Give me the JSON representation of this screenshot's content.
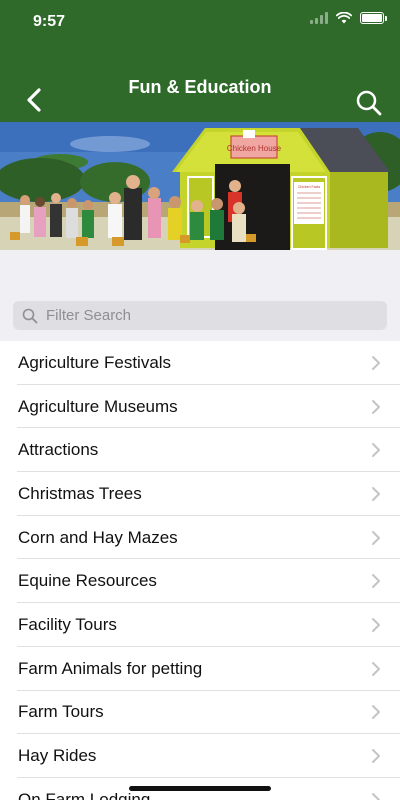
{
  "status_bar": {
    "time": "9:57"
  },
  "nav": {
    "title": "Fun & Education"
  },
  "hero": {
    "sign_text": "Chicken House",
    "notice_text": "Chicken Facts"
  },
  "search": {
    "placeholder": "Filter Search"
  },
  "categories": [
    {
      "label": "Agriculture Festivals"
    },
    {
      "label": "Agriculture Museums"
    },
    {
      "label": "Attractions"
    },
    {
      "label": "Christmas Trees"
    },
    {
      "label": "Corn and Hay Mazes"
    },
    {
      "label": "Equine Resources"
    },
    {
      "label": "Facility Tours"
    },
    {
      "label": "Farm Animals for petting"
    },
    {
      "label": "Farm Tours"
    },
    {
      "label": "Hay Rides"
    },
    {
      "label": "On Farm Lodging"
    }
  ],
  "colors": {
    "header_green": "#2f6a2b",
    "barn_yellow": "#c4d42a",
    "sky_blue": "#4a7fc8"
  },
  "icons": {
    "back": "chevron-left-icon",
    "search": "search-icon",
    "row": "chevron-right-icon"
  }
}
